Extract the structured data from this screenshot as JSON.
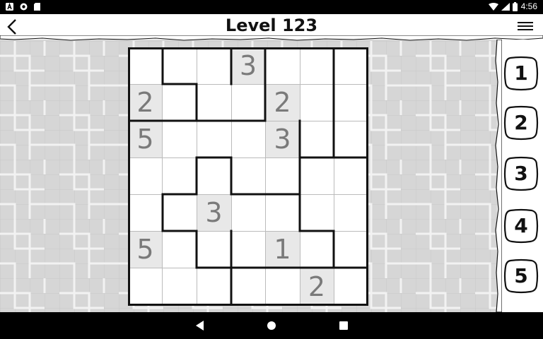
{
  "statusbar": {
    "time": "4:56"
  },
  "header": {
    "title": "Level 123"
  },
  "puzzle": {
    "rows": [
      [
        "",
        "",
        "",
        "3",
        "",
        "",
        ""
      ],
      [
        "2",
        "",
        "",
        "",
        "2",
        "",
        ""
      ],
      [
        "5",
        "",
        "",
        "",
        "3",
        "",
        ""
      ],
      [
        "",
        "",
        "",
        "",
        "",
        "",
        ""
      ],
      [
        "",
        "",
        "3",
        "",
        "",
        "",
        ""
      ],
      [
        "5",
        "",
        "",
        "",
        "1",
        "",
        ""
      ],
      [
        "",
        "",
        "",
        "",
        "",
        "2",
        ""
      ]
    ]
  },
  "number_pad": [
    "1",
    "2",
    "3",
    "4",
    "5"
  ]
}
